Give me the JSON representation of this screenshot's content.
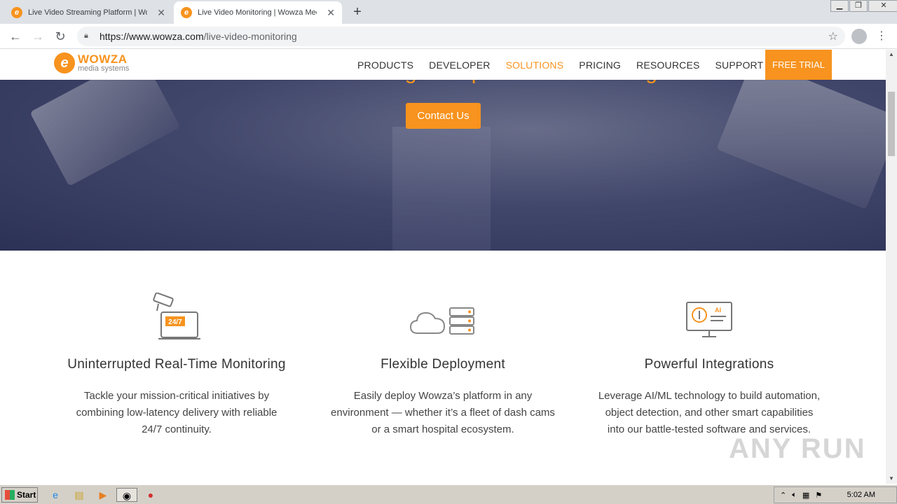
{
  "browser": {
    "tabs": [
      {
        "title": "Live Video Streaming Platform | Wowza",
        "active": false
      },
      {
        "title": "Live Video Monitoring | Wowza Media",
        "active": true
      }
    ],
    "url_host": "https://www.wowza.com",
    "url_path": "/live-video-monitoring"
  },
  "site": {
    "logo": {
      "brand": "WOWZA",
      "sub": "media systems"
    },
    "nav": [
      "PRODUCTS",
      "DEVELOPER",
      "SOLUTIONS",
      "PRICING",
      "RESOURCES",
      "SUPPORT"
    ],
    "active_nav": "SOLUTIONS",
    "free_trial": "FREE TRIAL",
    "accent_color": "#f7931e"
  },
  "hero": {
    "tagline": "Real-time streaming for rapid decision-making",
    "cta": "Contact Us"
  },
  "features": [
    {
      "icon": "cctv-247-icon",
      "icon_text": "24/7",
      "title": "Uninterrupted Real-Time Monitoring",
      "desc_lines": [
        "Tackle your mission-critical initiatives by",
        "combining low-latency delivery with reliable",
        "24/7 continuity."
      ]
    },
    {
      "icon": "cloud-server-icon",
      "title": "Flexible Deployment",
      "desc_lines": [
        "Easily deploy Wowza’s platform in any",
        "environment — whether it’s a fleet of dash cams",
        "or a smart hospital ecosystem."
      ]
    },
    {
      "icon": "ai-monitor-icon",
      "icon_text": "AI",
      "title": "Powerful Integrations",
      "desc_lines": [
        "Leverage AI/ML technology to build automation,",
        "object detection, and other smart capabilities",
        "into our battle-tested software and services."
      ]
    }
  ],
  "watermark": "ANY RUN",
  "taskbar": {
    "start": "Start",
    "clock": "5:02 AM"
  }
}
